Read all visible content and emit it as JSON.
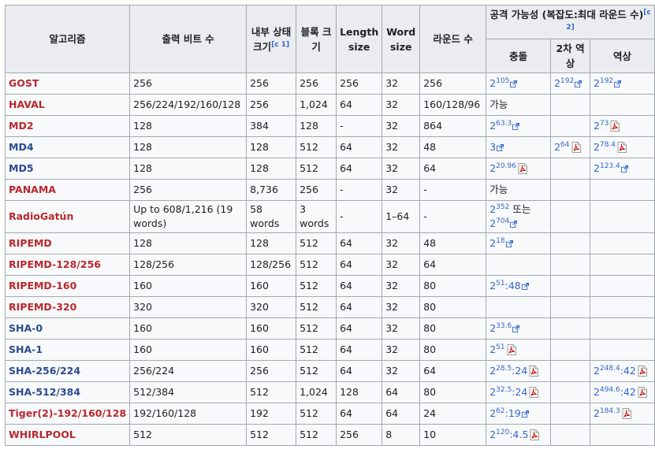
{
  "headers": {
    "algorithm": "알고리즘",
    "output_bits": "출력 비트 수",
    "internal_state": "내부 상태 크기",
    "internal_state_ref": "[c 1]",
    "block_size": "블록 크기",
    "length_size": "Length size",
    "word_size": "Word size",
    "rounds": "라운드 수",
    "attack": "공격 가능성 (복잡도:최대 라운드 수)",
    "attack_ref": "[c 2]",
    "collision": "충돌",
    "second_preimage": "2차 역상",
    "preimage": "역상"
  },
  "icons": {
    "external_link": "external-link-icon",
    "pdf": "pdf-icon"
  },
  "rows": [
    {
      "name": "GOST",
      "link": "red",
      "output": "256",
      "state": "256",
      "block": "256",
      "length": "256",
      "word": "32",
      "rounds": "256",
      "collision": {
        "base": "2",
        "exp": "105",
        "tail": "",
        "icon": "ext"
      },
      "second": {
        "base": "2",
        "exp": "192",
        "tail": "",
        "icon": "ext"
      },
      "pre": {
        "base": "2",
        "exp": "192",
        "tail": "",
        "icon": "ext"
      }
    },
    {
      "name": "HAVAL",
      "link": "red",
      "output": "256/224/192/160/128",
      "state": "256",
      "block": "1,024",
      "length": "64",
      "word": "32",
      "rounds": "160/128/96",
      "collision": {
        "text": "가능"
      },
      "second": null,
      "pre": null
    },
    {
      "name": "MD2",
      "link": "red",
      "output": "128",
      "state": "384",
      "block": "128",
      "length": "-",
      "word": "32",
      "rounds": "864",
      "collision": {
        "base": "2",
        "exp": "63.3",
        "tail": "",
        "icon": "ext"
      },
      "second": null,
      "pre": {
        "base": "2",
        "exp": "73",
        "tail": "",
        "icon": "pdf"
      }
    },
    {
      "name": "MD4",
      "link": "blue",
      "output": "128",
      "state": "128",
      "block": "512",
      "length": "64",
      "word": "32",
      "rounds": "48",
      "collision": {
        "base": "3",
        "exp": "",
        "tail": "",
        "icon": "ext"
      },
      "second": {
        "base": "2",
        "exp": "64",
        "tail": "",
        "icon": "pdf"
      },
      "pre": {
        "base": "2",
        "exp": "78.4",
        "tail": "",
        "icon": "pdf"
      }
    },
    {
      "name": "MD5",
      "link": "blue",
      "output": "128",
      "state": "128",
      "block": "512",
      "length": "64",
      "word": "32",
      "rounds": "64",
      "collision": {
        "base": "2",
        "exp": "20.96",
        "tail": "",
        "icon": "pdf"
      },
      "second": null,
      "pre": {
        "base": "2",
        "exp": "123.4",
        "tail": "",
        "icon": "ext"
      }
    },
    {
      "name": "PANAMA",
      "link": "red",
      "output": "256",
      "state": "8,736",
      "block": "256",
      "length": "-",
      "word": "32",
      "rounds": "-",
      "collision": {
        "text": "가능"
      },
      "second": null,
      "pre": null
    },
    {
      "name": "RadioGatún",
      "link": "red",
      "output": "Up to 608/1,216 (19 words)",
      "state": "58 words",
      "block": "3 words",
      "length": "-",
      "word": "1–64",
      "rounds": "-",
      "collision": {
        "line1_base": "2",
        "line1_exp": "352",
        "line1_text": " 또는",
        "base": "2",
        "exp": "704",
        "tail": "",
        "icon": "ext"
      },
      "second": null,
      "pre": null
    },
    {
      "name": "RIPEMD",
      "link": "red",
      "output": "128",
      "state": "128",
      "block": "512",
      "length": "64",
      "word": "32",
      "rounds": "48",
      "collision": {
        "base": "2",
        "exp": "18",
        "tail": "",
        "icon": "ext"
      },
      "second": null,
      "pre": null
    },
    {
      "name": "RIPEMD-128/256",
      "link": "red",
      "output": "128/256",
      "state": "128/256",
      "block": "512",
      "length": "64",
      "word": "32",
      "rounds": "64",
      "collision": null,
      "second": null,
      "pre": null
    },
    {
      "name": "RIPEMD-160",
      "link": "red",
      "output": "160",
      "state": "160",
      "block": "512",
      "length": "64",
      "word": "32",
      "rounds": "80",
      "collision": {
        "base": "2",
        "exp": "51",
        "tail": ":48",
        "icon": "ext"
      },
      "second": null,
      "pre": null
    },
    {
      "name": "RIPEMD-320",
      "link": "red",
      "output": "320",
      "state": "320",
      "block": "512",
      "length": "64",
      "word": "32",
      "rounds": "80",
      "collision": null,
      "second": null,
      "pre": null
    },
    {
      "name": "SHA-0",
      "link": "blue",
      "output": "160",
      "state": "160",
      "block": "512",
      "length": "64",
      "word": "32",
      "rounds": "80",
      "collision": {
        "base": "2",
        "exp": "33.6",
        "tail": "",
        "icon": "ext"
      },
      "second": null,
      "pre": null
    },
    {
      "name": "SHA-1",
      "link": "blue",
      "output": "160",
      "state": "160",
      "block": "512",
      "length": "64",
      "word": "32",
      "rounds": "80",
      "collision": {
        "base": "2",
        "exp": "51",
        "tail": "",
        "icon": "pdf"
      },
      "second": null,
      "pre": null
    },
    {
      "name": "SHA-256/224",
      "link": "blue",
      "output": "256/224",
      "state": "256",
      "block": "512",
      "length": "64",
      "word": "32",
      "rounds": "64",
      "collision": {
        "base": "2",
        "exp": "28.5",
        "tail": ":24",
        "icon": "pdf"
      },
      "second": null,
      "pre": {
        "base": "2",
        "exp": "248.4",
        "tail": ":42",
        "icon": "pdf"
      }
    },
    {
      "name": "SHA-512/384",
      "link": "blue",
      "output": "512/384",
      "state": "512",
      "block": "1,024",
      "length": "128",
      "word": "64",
      "rounds": "80",
      "collision": {
        "base": "2",
        "exp": "32.5",
        "tail": ":24",
        "icon": "pdf"
      },
      "second": null,
      "pre": {
        "base": "2",
        "exp": "494.6",
        "tail": ":42",
        "icon": "pdf"
      }
    },
    {
      "name": "Tiger(2)-192/160/128",
      "link": "red",
      "output": "192/160/128",
      "state": "192",
      "block": "512",
      "length": "64",
      "word": "64",
      "rounds": "24",
      "collision": {
        "base": "2",
        "exp": "62",
        "tail": ":19",
        "icon": "ext"
      },
      "second": null,
      "pre": {
        "base": "2",
        "exp": "184.3",
        "tail": "",
        "icon": "pdf"
      }
    },
    {
      "name": "WHIRLPOOL",
      "link": "red",
      "output": "512",
      "state": "512",
      "block": "512",
      "length": "256",
      "word": "8",
      "rounds": "10",
      "collision": {
        "base": "2",
        "exp": "120",
        "tail": ":4.5",
        "icon": "pdf"
      },
      "second": null,
      "pre": null
    }
  ]
}
